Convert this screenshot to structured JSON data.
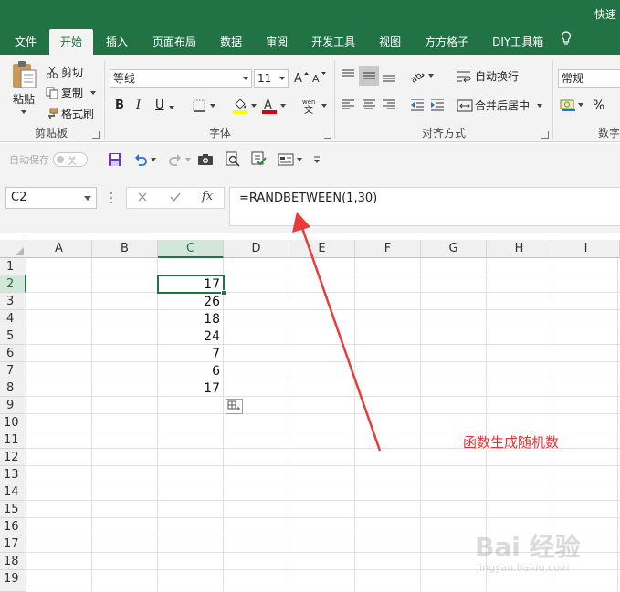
{
  "window": {
    "quick_access_label": "快速"
  },
  "ribbon_tabs": [
    "文件",
    "开始",
    "插入",
    "页面布局",
    "数据",
    "审阅",
    "开发工具",
    "视图",
    "方方格子",
    "DIY工具箱"
  ],
  "active_tab": "开始",
  "clipboard": {
    "paste_label": "粘贴",
    "cut_label": "剪切",
    "copy_label": "复制",
    "format_painter_label": "格式刷",
    "group_label": "剪贴板"
  },
  "font": {
    "font_name": "等线",
    "font_size": "11",
    "bold": "B",
    "italic": "I",
    "underline": "U",
    "group_label": "字体"
  },
  "alignment": {
    "wrap_label": "自动换行",
    "merge_label": "合并后居中",
    "group_label": "对齐方式"
  },
  "number": {
    "format_value": "常规",
    "percent": "%",
    "group_label": "数字"
  },
  "quick_access": {
    "autosave_label": "自动保存",
    "toggle_state": "关"
  },
  "formula_bar": {
    "name_box": "C2",
    "formula": "=RANDBETWEEN(1,30)"
  },
  "sheet": {
    "columns": [
      "A",
      "B",
      "C",
      "D",
      "E",
      "F",
      "G",
      "H",
      "I"
    ],
    "selected_column": "C",
    "rows": [
      "1",
      "2",
      "3",
      "4",
      "5",
      "6",
      "7",
      "8",
      "9",
      "10",
      "11",
      "12",
      "13",
      "14",
      "15",
      "16",
      "17",
      "18",
      "19"
    ],
    "selected_row": "2",
    "column_c_values": [
      "17",
      "26",
      "18",
      "24",
      "7",
      "6",
      "17"
    ]
  },
  "annotation": {
    "text": "函数生成随机数",
    "color": "#e53333"
  },
  "watermark": {
    "text": "Bai 经验",
    "sub": "jingyan.baidu.com"
  },
  "colors": {
    "accent": "#217346"
  }
}
